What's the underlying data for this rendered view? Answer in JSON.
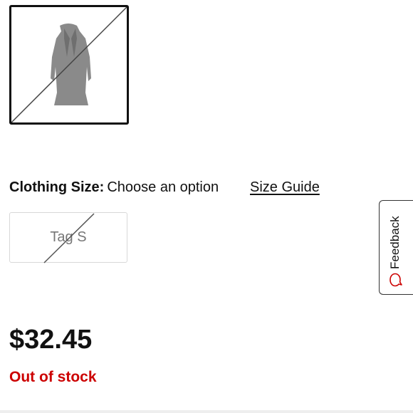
{
  "product": {
    "price": "$32.45",
    "stock_status": "Out of stock"
  },
  "size_selector": {
    "label": "Clothing Size:",
    "selected_value": "Choose an option",
    "size_guide_link": "Size Guide",
    "options": [
      {
        "label": "Tag S",
        "available": false
      }
    ]
  },
  "feedback_tab": {
    "label": "Feedback",
    "icon": "speech-bubble-icon"
  },
  "colors": {
    "out_of_stock": "#cc0000",
    "text": "#111111"
  }
}
